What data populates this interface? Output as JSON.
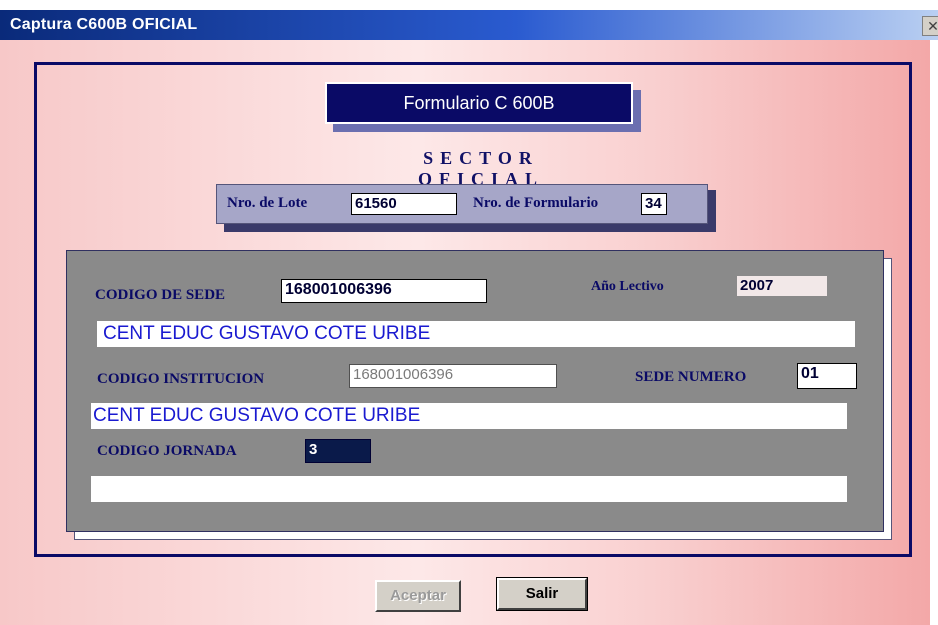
{
  "window": {
    "title": "Captura C600B OFICIAL",
    "close_glyph": "✕"
  },
  "header": {
    "form_title": "Formulario C 600B",
    "sector": "SECTOR  OFICIAL"
  },
  "lote": {
    "lote_label": "Nro. de Lote",
    "lote_value": "61560",
    "formulario_label": "Nro. de Formulario",
    "formulario_value": "34"
  },
  "sede": {
    "codigo_sede_label": "CODIGO DE SEDE",
    "codigo_sede_value": "168001006396",
    "anio_label": "Año Lectivo",
    "anio_value": "2007",
    "sede_name": "CENT EDUC GUSTAVO COTE URIBE",
    "codigo_institucion_label": "CODIGO INSTITUCION",
    "codigo_institucion_value": "168001006396",
    "sede_numero_label": "SEDE NUMERO",
    "sede_numero_value": "01",
    "institucion_name": "CENT EDUC GUSTAVO COTE URIBE",
    "codigo_jornada_label": "CODIGO JORNADA",
    "codigo_jornada_value": "3",
    "jornada_name": ""
  },
  "buttons": {
    "aceptar": "Aceptar",
    "salir": "Salir"
  },
  "colors": {
    "title_bar": "#0a2a7a",
    "background": "#f7c8c8",
    "panel": "#8a8a8a",
    "navy": "#0a0a66",
    "name_text": "#1a1ad0"
  },
  "icons": {
    "close": "close-icon"
  }
}
